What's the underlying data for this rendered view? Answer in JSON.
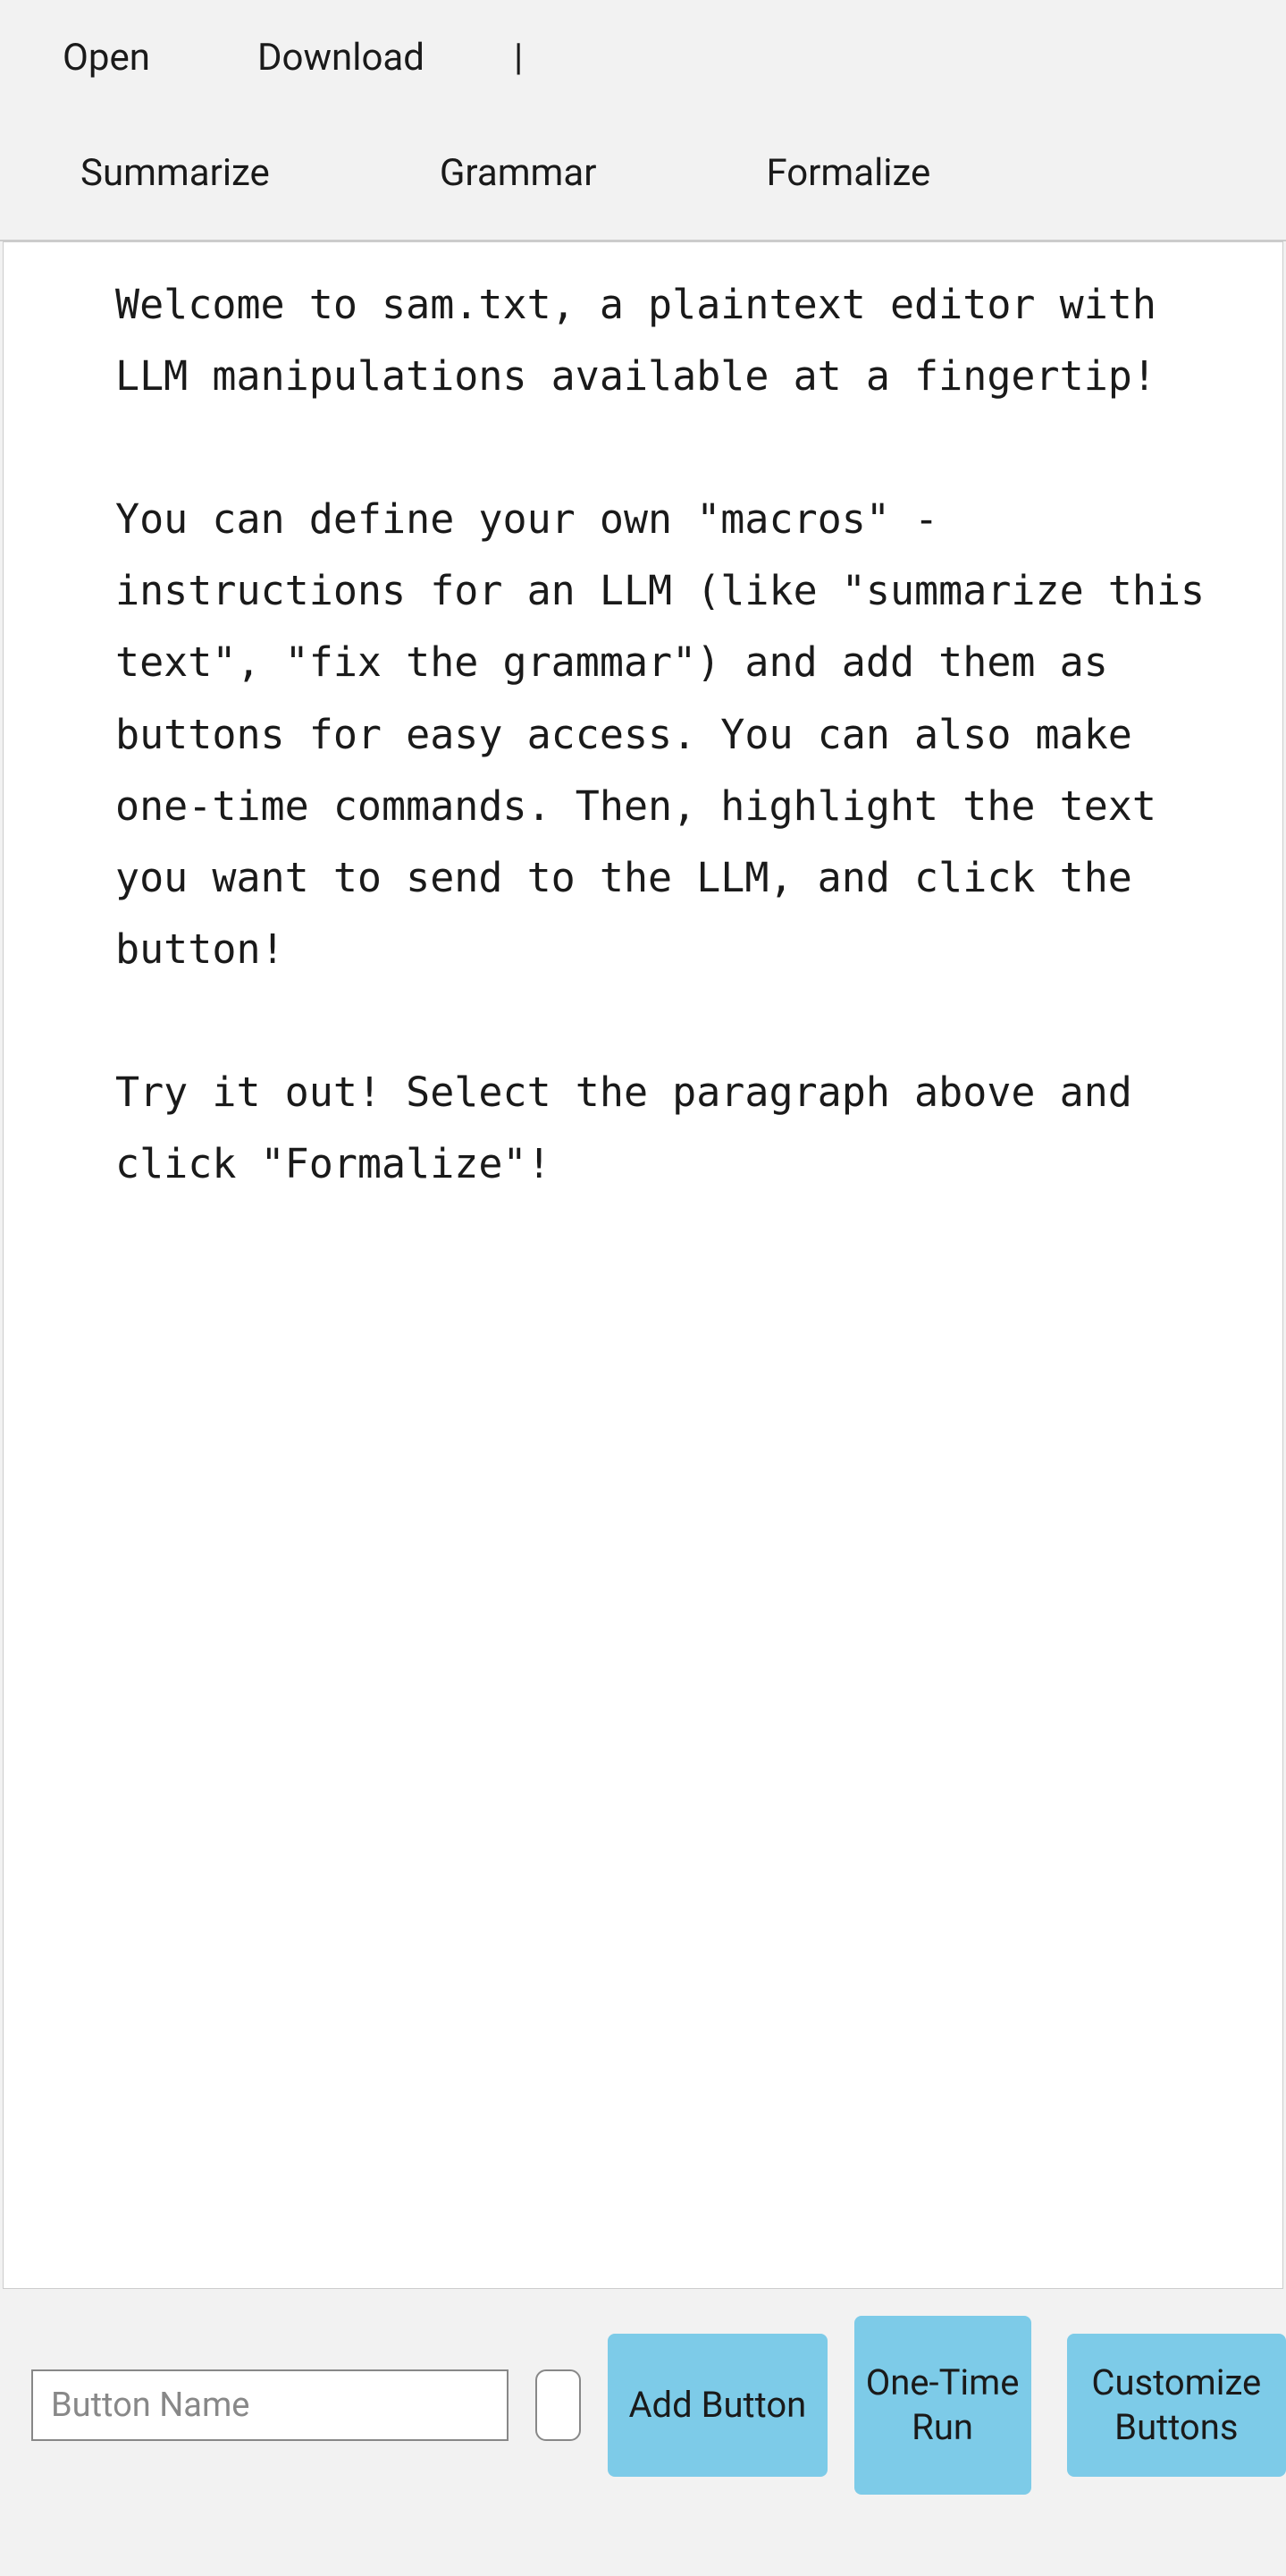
{
  "toolbar": {
    "open_label": "Open",
    "download_label": "Download",
    "separator": "|",
    "summarize_label": "Summarize",
    "grammar_label": "Grammar",
    "formalize_label": "Formalize"
  },
  "editor": {
    "content": "Welcome to sam.txt, a plaintext editor with LLM manipulations available at a fingertip!\n\nYou can define your own \"macros\" - instructions for an LLM (like \"summarize this text\", \"fix the grammar\") and add them as buttons for easy access. You can also make one-time commands. Then, highlight the text you want to send to the LLM, and click the button!\n\nTry it out! Select the paragraph above and click \"Formalize\"!"
  },
  "bottom": {
    "button_name_placeholder": "Button Name",
    "add_button_label": "Add Button",
    "one_time_run_label": "One-Time Run",
    "customize_buttons_label": "Customize Buttons"
  }
}
